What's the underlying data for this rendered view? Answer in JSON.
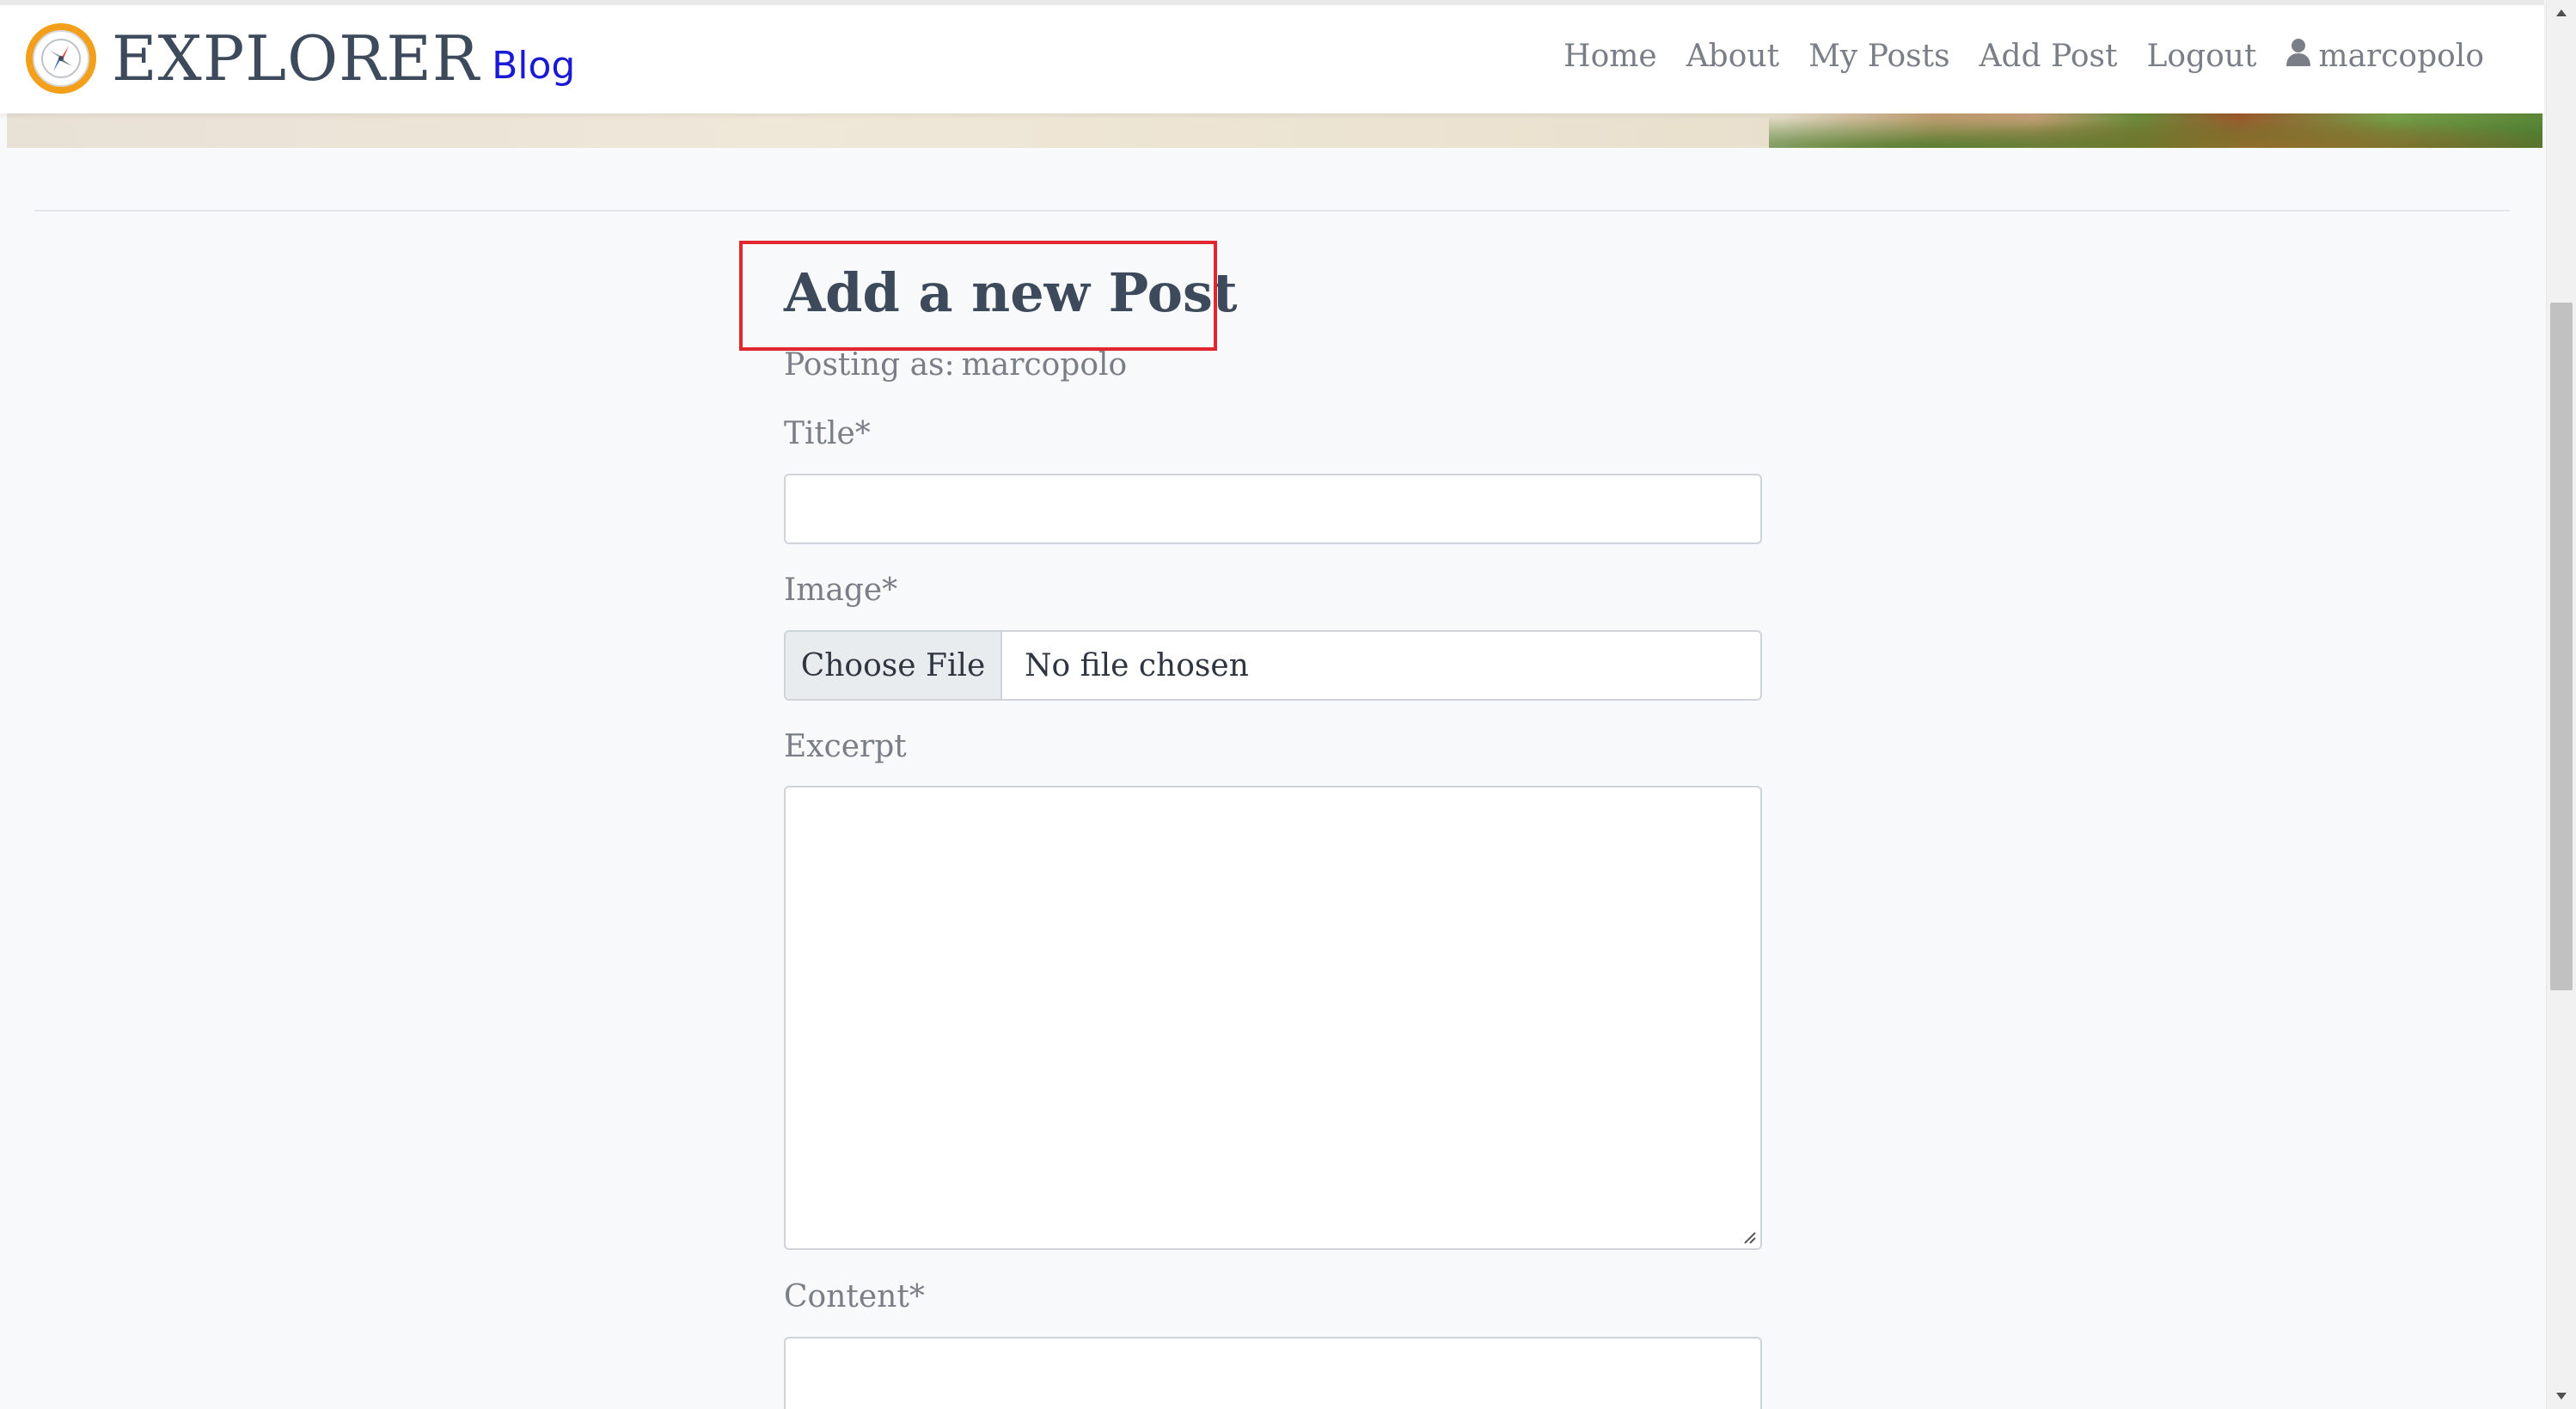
{
  "header": {
    "brand_title": "EXPLORER",
    "brand_sub": "Blog",
    "nav": {
      "home": "Home",
      "about": "About",
      "my_posts": "My Posts",
      "add_post": "Add Post",
      "logout": "Logout",
      "username": "marcopolo"
    },
    "user_icon": "user-icon",
    "logo_icon": "compass-icon"
  },
  "main": {
    "title": "Add a new Post",
    "posting_as_label": "Posting as:",
    "posting_as_user": "marcopolo",
    "fields": {
      "title_label": "Title*",
      "title_value": "",
      "image_label": "Image*",
      "image_button": "Choose File",
      "image_status": "No file chosen",
      "excerpt_label": "Excerpt",
      "excerpt_value": "",
      "content_label": "Content*",
      "content_value": ""
    }
  },
  "colors": {
    "brand_sub": "#1a1ad6",
    "logo_ring": "#f2a01b",
    "highlight_box": "#e0262e",
    "text_primary": "#3d4a5b",
    "text_muted": "#7a7f87"
  }
}
